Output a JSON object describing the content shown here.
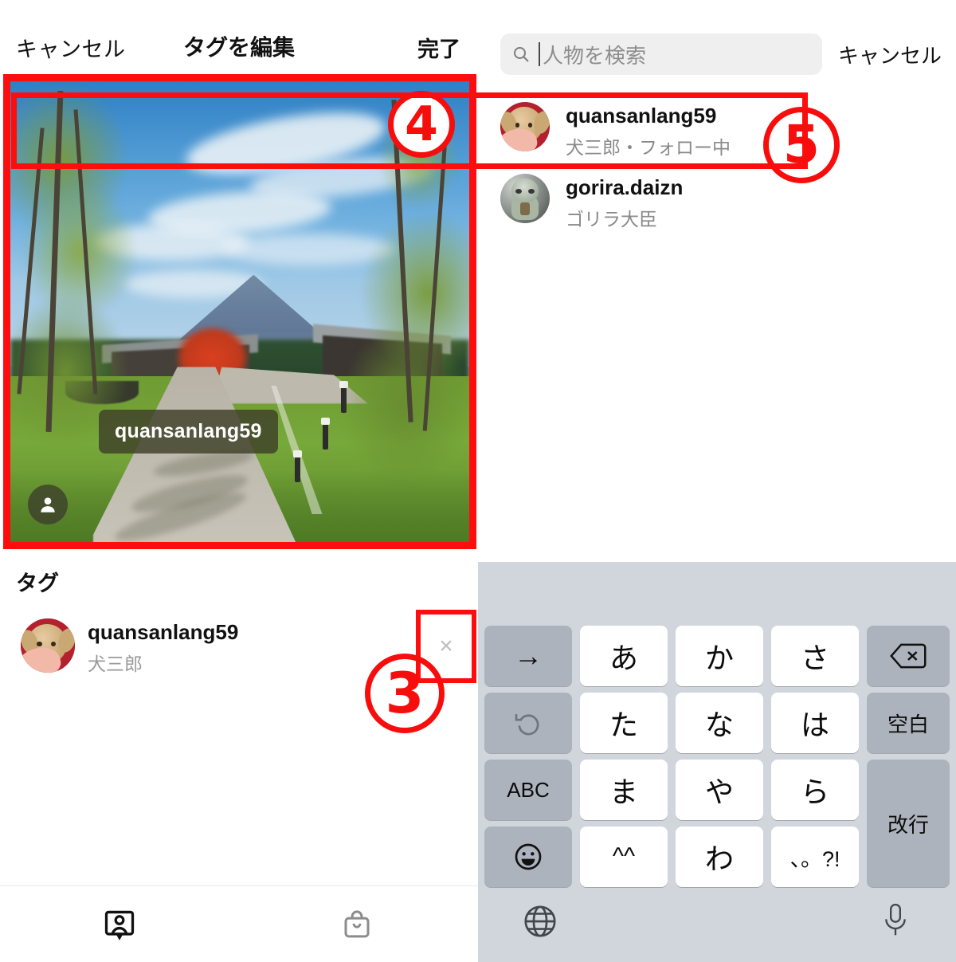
{
  "left": {
    "nav": {
      "cancel_label": "キャンセル",
      "title": "タグを編集",
      "done_label": "完了"
    },
    "photo": {
      "tag_pill_label": "quansanlang59",
      "person_badge_icon": "person-icon"
    },
    "tag_section": {
      "title": "タグ",
      "rows": [
        {
          "username": "quansanlang59",
          "fullname": "犬三郎",
          "remove_label": "×"
        }
      ]
    },
    "tab_bar": {
      "tabs": [
        {
          "icon": "person-tag-icon",
          "active": true
        },
        {
          "icon": "shopping-bag-icon",
          "active": false
        }
      ]
    }
  },
  "right": {
    "search": {
      "icon": "search-icon",
      "placeholder": "人物を検索",
      "value": "",
      "cancel_label": "キャンセル"
    },
    "results": [
      {
        "username": "quansanlang59",
        "subtitle": "犬三郎・フォロー中",
        "avatar": "dog-avatar"
      },
      {
        "username": "gorira.daizn",
        "subtitle": "ゴリラ大臣",
        "avatar": "gorilla-avatar"
      }
    ]
  },
  "keyboard": {
    "rows": [
      [
        {
          "label": "→",
          "type": "dark",
          "name": "cursor-right-key"
        },
        {
          "label": "あ",
          "type": "light",
          "name": "kana-a-key"
        },
        {
          "label": "か",
          "type": "light",
          "name": "kana-ka-key"
        },
        {
          "label": "さ",
          "type": "light",
          "name": "kana-sa-key"
        },
        {
          "label": "⌫",
          "type": "dark",
          "name": "backspace-key"
        }
      ],
      [
        {
          "label": "↺",
          "type": "dark",
          "name": "undo-key"
        },
        {
          "label": "た",
          "type": "light",
          "name": "kana-ta-key"
        },
        {
          "label": "な",
          "type": "light",
          "name": "kana-na-key"
        },
        {
          "label": "は",
          "type": "light",
          "name": "kana-ha-key"
        },
        {
          "label": "空白",
          "type": "dark",
          "name": "space-key"
        }
      ],
      [
        {
          "label": "ABC",
          "type": "dark",
          "name": "abc-key"
        },
        {
          "label": "ま",
          "type": "light",
          "name": "kana-ma-key"
        },
        {
          "label": "や",
          "type": "light",
          "name": "kana-ya-key"
        },
        {
          "label": "ら",
          "type": "light",
          "name": "kana-ra-key"
        },
        {
          "label": "改行",
          "type": "dark",
          "name": "return-key"
        }
      ],
      [
        {
          "label": "☺",
          "type": "dark",
          "name": "emoji-key"
        },
        {
          "label": "^^",
          "type": "light",
          "name": "caret-key"
        },
        {
          "label": "わ",
          "type": "light",
          "name": "kana-wa-key"
        },
        {
          "label": "、。?!",
          "type": "light",
          "name": "punctuation-key"
        }
      ]
    ],
    "bottom": {
      "globe_icon": "globe-icon",
      "mic_icon": "microphone-icon"
    }
  },
  "annotations": {
    "steps": [
      {
        "number": "3",
        "target": "remove-tag-button"
      },
      {
        "number": "4",
        "target": "photo-area"
      },
      {
        "number": "5",
        "target": "search-result-row-1"
      }
    ],
    "highlight_color": "#fd0d0d"
  }
}
